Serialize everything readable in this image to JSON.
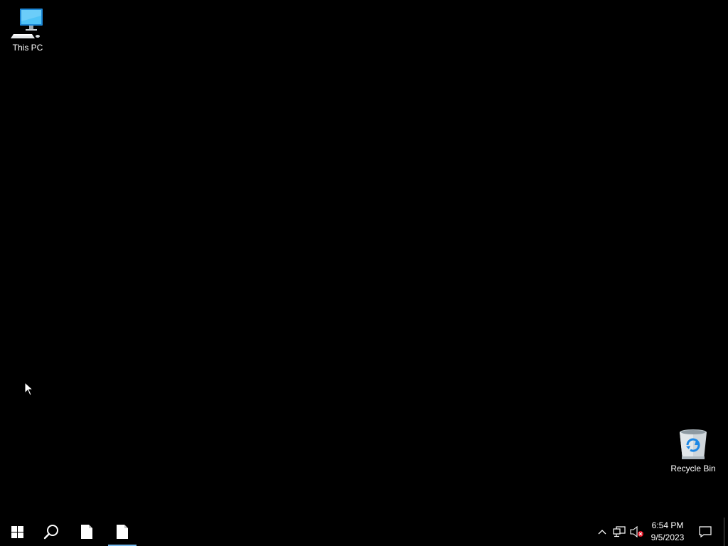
{
  "desktop": {
    "icons": [
      {
        "label": "This PC",
        "icon": "this-pc-icon"
      },
      {
        "label": "Recycle Bin",
        "icon": "recycle-bin-icon"
      }
    ]
  },
  "taskbar": {
    "start_icon": "windows-logo-icon",
    "search_icon": "search-icon",
    "tasks": [
      {
        "icon": "blank-file-icon",
        "active": false
      },
      {
        "icon": "blank-file-icon",
        "active": true
      }
    ],
    "tray": {
      "chevron_icon": "chevron-up-icon",
      "network_icon": "network-icon",
      "volume_icon": "volume-muted-icon"
    },
    "clock": {
      "time": "6:54 PM",
      "date": "9/5/2023"
    },
    "notifications_icon": "action-center-icon"
  },
  "colors": {
    "background": "#000000",
    "taskbar": "#000000",
    "active_indicator": "#76b9ed",
    "text": "#ffffff"
  }
}
